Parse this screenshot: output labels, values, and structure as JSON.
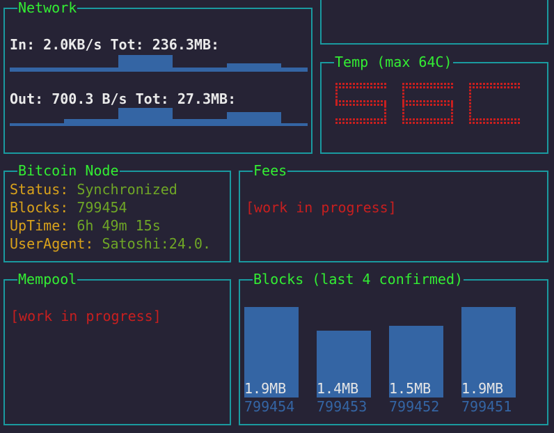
{
  "network": {
    "title": "Network",
    "in_line": "In: 2.0KB/s Tot: 236.3MB:",
    "out_line": "Out: 700.3 B/s Tot: 27.3MB:",
    "in_series": [
      1,
      1,
      4,
      1,
      2,
      1
    ],
    "out_series": [
      1,
      3,
      8,
      3,
      6,
      1
    ]
  },
  "temp": {
    "title": "Temp (max 64C)",
    "value": "56C",
    "color": "#c81f1f"
  },
  "bitcoin_node": {
    "title": "Bitcoin Node",
    "rows": [
      {
        "key": "Status: ",
        "value": "Synchronized"
      },
      {
        "key": "Blocks: ",
        "value": "799454"
      },
      {
        "key": "UpTime: ",
        "value": "6h 49m 15s"
      },
      {
        "key": "UserAgent: ",
        "value": "Satoshi:24.0."
      }
    ]
  },
  "fees": {
    "title": "Fees",
    "status": "[work in progress]"
  },
  "mempool": {
    "title": "Mempool",
    "status": "[work in progress]"
  },
  "blocks": {
    "title": "Blocks (last 4 confirmed)",
    "items": [
      {
        "size_label": "1.9MB",
        "size": 1.9,
        "height": "799454"
      },
      {
        "size_label": "1.4MB",
        "size": 1.4,
        "height": "799453"
      },
      {
        "size_label": "1.5MB",
        "size": 1.5,
        "height": "799452"
      },
      {
        "size_label": "1.9MB",
        "size": 1.9,
        "height": "799451"
      }
    ]
  }
}
